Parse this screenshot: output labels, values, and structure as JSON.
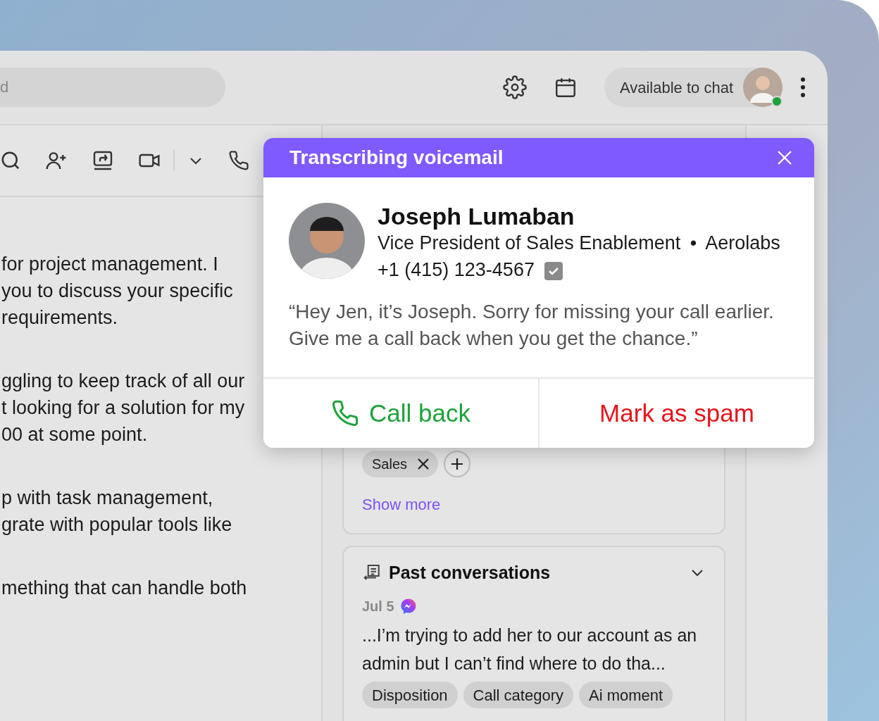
{
  "search": {
    "placeholder": "d"
  },
  "header": {
    "status": "Available to chat",
    "online": true
  },
  "messages": [
    {
      "lines": [
        "for project management. I",
        "you to discuss your specific",
        "requirements."
      ]
    },
    {
      "lines": [
        "ggling to keep track of all our",
        "t looking for a solution for my",
        "00 at some point."
      ]
    },
    {
      "lines": [
        "p with task management,",
        "grate with popular tools like"
      ]
    },
    {
      "lines": [
        "mething that can handle both"
      ]
    }
  ],
  "contact_card": {
    "tags": [
      {
        "label": "Sales"
      }
    ],
    "show_more": "Show more"
  },
  "past_conversations": {
    "title": "Past conversations",
    "items": [
      {
        "date": "Jul 5",
        "text": "...I’m trying to add her to our account as an admin but I can’t find where to do tha...",
        "tags": [
          "Disposition",
          "Call category",
          "Ai moment"
        ]
      }
    ]
  },
  "voicemail_popup": {
    "title": "Transcribing voicemail",
    "name": "Joseph Lumaban",
    "job_title": "Vice President of Sales Enablement",
    "separator": "•",
    "company": "Aerolabs",
    "phone": "+1 (415) 123-4567",
    "verified": true,
    "transcript": "“Hey Jen, it’s Joseph. Sorry for missing your call earlier. Give me a call back when you get the chance.”",
    "actions": [
      {
        "label": "Call back",
        "kind": "call"
      },
      {
        "label": "Mark as spam",
        "kind": "spam"
      }
    ]
  }
}
